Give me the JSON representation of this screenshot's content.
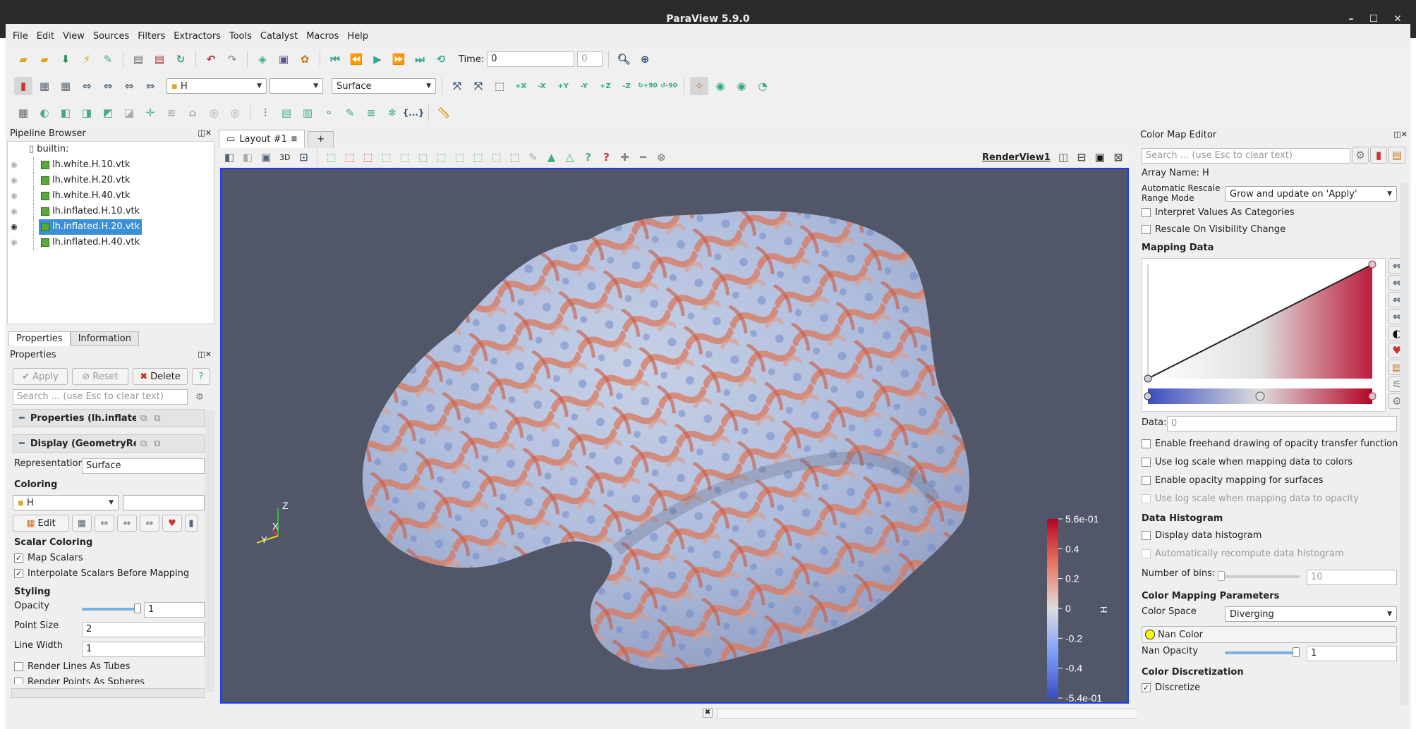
{
  "window": {
    "title": "ParaView 5.9.0",
    "minimize": "–",
    "maximize": "☐",
    "close": "✕"
  },
  "menu": [
    "File",
    "Edit",
    "View",
    "Sources",
    "Filters",
    "Extractors",
    "Tools",
    "Catalyst",
    "Macros",
    "Help"
  ],
  "toolbar": {
    "time_label": "Time:",
    "time_value": "0",
    "time_index": "0",
    "array_combo": "H",
    "component_combo": "",
    "representation_combo": "Surface",
    "rot_plus90": "+90",
    "rot_minus90": "-90",
    "axis_buttons": [
      "+X",
      "-X",
      "+Y",
      "-Y",
      "+Z",
      "-Z"
    ]
  },
  "pipeline": {
    "title": "Pipeline Browser",
    "root": "builtin:",
    "items": [
      {
        "label": "lh.white.H.10.vtk",
        "selected": false,
        "visible": false
      },
      {
        "label": "lh.white.H.20.vtk",
        "selected": false,
        "visible": false
      },
      {
        "label": "lh.white.H.40.vtk",
        "selected": false,
        "visible": false
      },
      {
        "label": "lh.inflated.H.10.vtk",
        "selected": false,
        "visible": false
      },
      {
        "label": "lh.inflated.H.20.vtk",
        "selected": true,
        "visible": true
      },
      {
        "label": "lh.inflated.H.40.vtk",
        "selected": false,
        "visible": false
      }
    ]
  },
  "props": {
    "tabs": [
      "Properties",
      "Information"
    ],
    "title": "Properties",
    "apply": "Apply",
    "reset": "Reset",
    "delete": "Delete",
    "help": "?",
    "search_placeholder": "Search ... (use Esc to clear text)",
    "group_properties": "Properties (lh.inflate",
    "group_display": "Display (GeometryRe",
    "representation_label": "Representation",
    "representation_value": "Surface",
    "coloring_section": "Coloring",
    "coloring_array": "H",
    "edit_label": "Edit",
    "scalar_coloring": "Scalar Coloring",
    "map_scalars": "Map Scalars",
    "interpolate": "Interpolate Scalars Before Mapping",
    "styling": "Styling",
    "opacity_label": "Opacity",
    "opacity_value": "1",
    "point_size_label": "Point Size",
    "point_size_value": "2",
    "line_width_label": "Line Width",
    "line_width_value": "1",
    "render_lines": "Render Lines As Tubes",
    "render_points": "Render Points As Spheres",
    "opacity_fraction": 1.0
  },
  "view": {
    "layout_tab": "Layout #1",
    "add_tab": "+",
    "render_view": "RenderView1",
    "threed": "3D",
    "bg_color": "#525669",
    "legend_title": "H",
    "legend_ticks": [
      "5.6e-01",
      "0.4",
      "0.2",
      "0",
      "-0.2",
      "-0.4",
      "-5.4e-01"
    ],
    "axes": {
      "z": "Z",
      "x": "X",
      "y": "Y"
    }
  },
  "cme": {
    "title": "Color Map Editor",
    "search_placeholder": "Search ... (use Esc to clear text)",
    "array_name": "Array Name: H",
    "rescale_label": "Automatic Rescale Range Mode",
    "rescale_value": "Grow and update on 'Apply'",
    "interpret_categories": "Interpret Values As Categories",
    "rescale_visibility": "Rescale On Visibility Change",
    "mapping_data": "Mapping Data",
    "data_label": "Data:",
    "data_value": "0",
    "freehand": "Enable freehand drawing of opacity transfer function",
    "log_colors": "Use log scale when mapping data to colors",
    "opacity_surfaces": "Enable opacity mapping for surfaces",
    "log_opacity": "Use log scale when mapping data to opacity",
    "histogram_section": "Data Histogram",
    "display_histogram": "Display data histogram",
    "auto_recompute": "Automatically recompute data histogram",
    "bins_label": "Number of bins:",
    "bins_value": "10",
    "color_params": "Color Mapping Parameters",
    "color_space_label": "Color Space",
    "color_space_value": "Diverging",
    "nan_color": "Nan Color",
    "nan_opacity_label": "Nan Opacity",
    "nan_opacity_value": "1",
    "nan_opacity_fraction": 1.0,
    "discretization": "Color Discretization",
    "discretize": "Discretize"
  },
  "colors": {
    "accent": "#3a8fd6",
    "selection": "#3b8fd6",
    "cold": "#3b4cc0",
    "hot": "#b40426",
    "nan": "#ffff00"
  }
}
